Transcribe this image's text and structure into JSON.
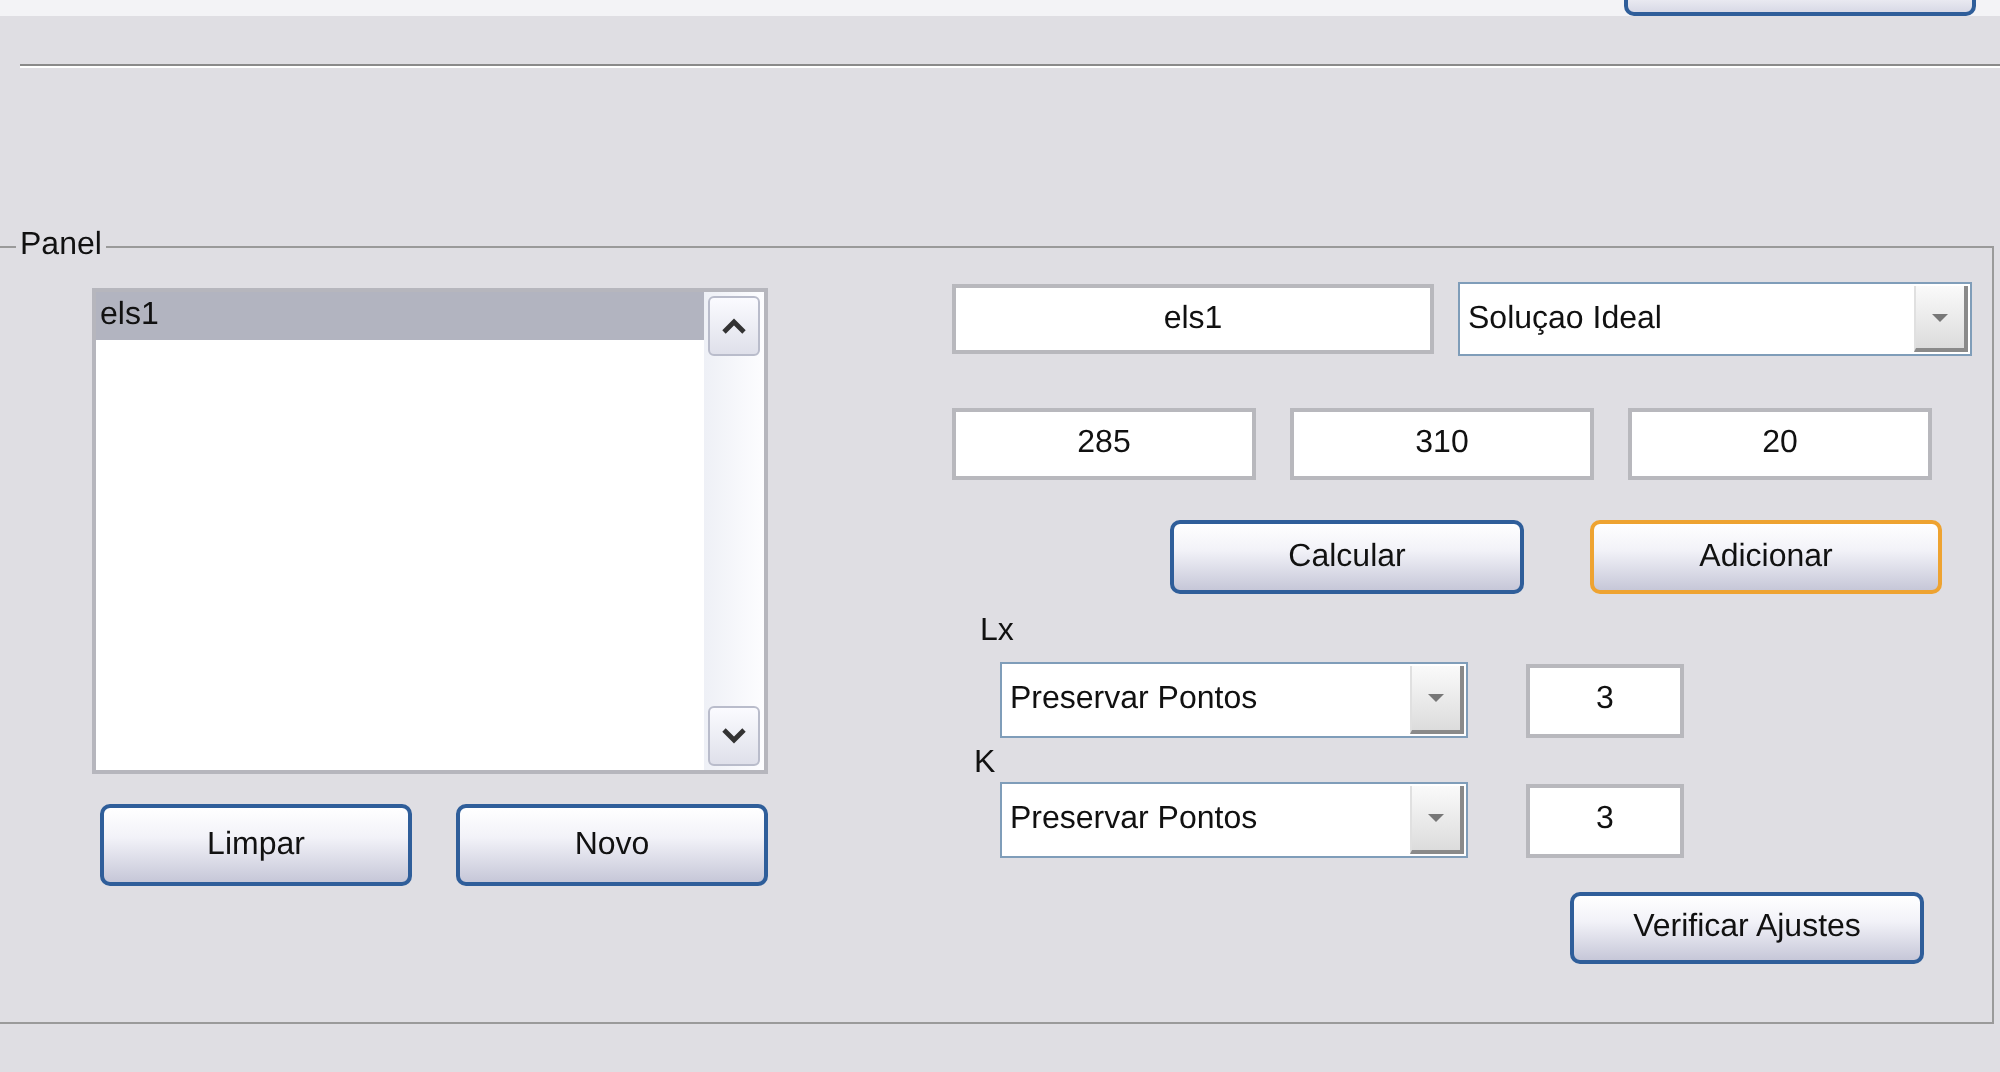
{
  "panel": {
    "title": "Panel",
    "list": {
      "items": [
        {
          "label": "els1",
          "selected": true
        }
      ]
    },
    "list_buttons": [
      "Limpar",
      "Novo"
    ],
    "name_field": {
      "value": "els1"
    },
    "solution_select": {
      "value": "Soluçao Ideal"
    },
    "coordinate_fields": [
      {
        "value": "285"
      },
      {
        "value": "310"
      },
      {
        "value": "20"
      }
    ],
    "action_buttons": [
      {
        "label": "Calcular",
        "focused": false
      },
      {
        "label": "Adicionar",
        "focused": true
      }
    ],
    "settings": [
      {
        "label": "Lx",
        "mode": "Preservar Pontos",
        "value": "3"
      },
      {
        "label": "K",
        "mode": "Preservar Pontos",
        "value": "3"
      }
    ],
    "verify_button": "Verificar Ajustes"
  }
}
